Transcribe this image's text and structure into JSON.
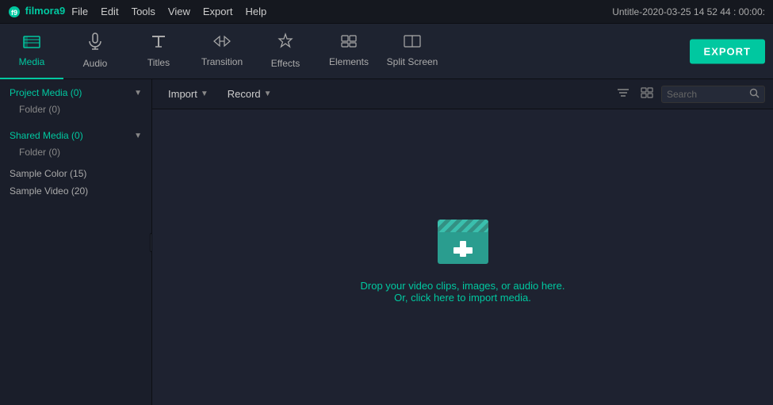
{
  "titleBar": {
    "appName": "filmora9",
    "menu": [
      "File",
      "Edit",
      "Tools",
      "View",
      "Export",
      "Help"
    ],
    "title": "Untitle-2020-03-25 14 52 44 : 00:00:"
  },
  "toolbar": {
    "items": [
      {
        "id": "media",
        "label": "Media",
        "icon": "🎞"
      },
      {
        "id": "audio",
        "label": "Audio",
        "icon": "♪"
      },
      {
        "id": "titles",
        "label": "Titles",
        "icon": "T"
      },
      {
        "id": "transition",
        "label": "Transition",
        "icon": "↔"
      },
      {
        "id": "effects",
        "label": "Effects",
        "icon": "✦"
      },
      {
        "id": "elements",
        "label": "Elements",
        "icon": "⬜"
      },
      {
        "id": "split-screen",
        "label": "Split Screen",
        "icon": "⧉"
      }
    ],
    "exportLabel": "EXPORT"
  },
  "sidebar": {
    "sections": [
      {
        "title": "Project Media (0)",
        "items": [
          "Folder (0)"
        ]
      },
      {
        "title": "Shared Media (0)",
        "items": [
          "Folder (0)"
        ]
      }
    ],
    "links": [
      "Sample Color (15)",
      "Sample Video (20)"
    ]
  },
  "contentToolbar": {
    "importLabel": "Import",
    "recordLabel": "Record",
    "searchPlaceholder": "Search"
  },
  "dropZone": {
    "text1": "Drop your video clips, images, or audio here.",
    "text2": "Or, click here to import media."
  }
}
